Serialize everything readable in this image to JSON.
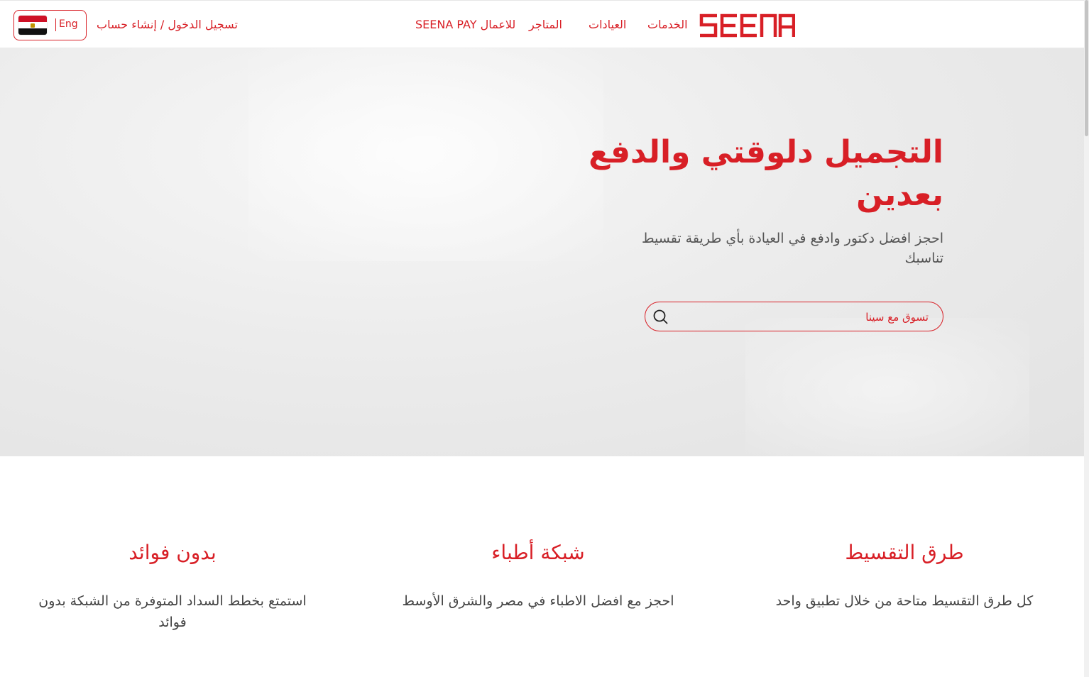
{
  "header": {
    "lang_label": "Eng",
    "auth_link": "تسجيل الدخول / إنشاء حساب",
    "nav": {
      "seena_pay": "SEENA PAY للاعمال",
      "stores": "المتاجر",
      "clinics": "العيادات",
      "services": "الخدمات"
    },
    "logo_text": "SEENA"
  },
  "hero": {
    "title": "التجميل دلوقتي والدفع بعدين",
    "subtitle": "احجز افضل دكتور وادفع في العيادة بأي طريقة تقسيط تناسبك",
    "search_placeholder": "تسوق مع سينا"
  },
  "features": [
    {
      "title": "طرق التقسيط",
      "text": "كل طرق التقسيط متاحة من خلال تطبيق واحد"
    },
    {
      "title": "شبكة أطباء",
      "text": "احجز مع افضل الاطباء في مصر والشرق الأوسط"
    },
    {
      "title": "بدون فوائد",
      "text": "استمتع بخطط السداد المتوفرة من الشبكة بدون فوائد"
    }
  ],
  "colors": {
    "brand_red": "#d81f26",
    "text_gray": "#555555"
  },
  "icons": {
    "search": "search-icon",
    "flag": "egypt-flag-icon"
  }
}
